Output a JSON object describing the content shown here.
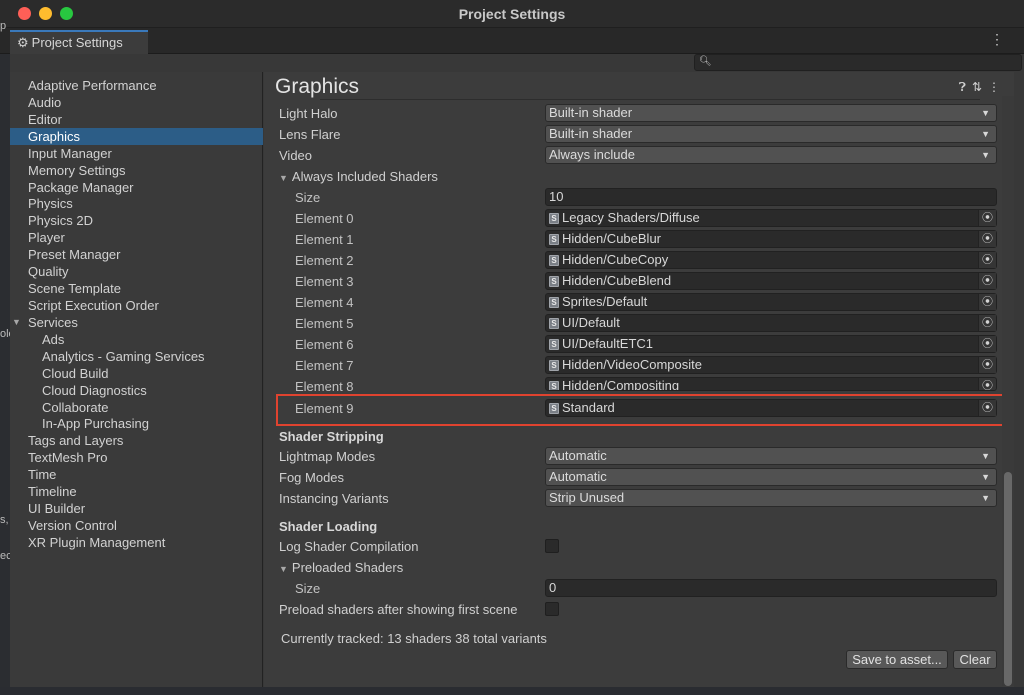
{
  "window": {
    "title": "Project Settings"
  },
  "tab": {
    "label": "Project Settings",
    "icon": "gear-icon"
  },
  "sidebar": {
    "items": [
      "Adaptive Performance",
      "Audio",
      "Editor",
      "Graphics",
      "Input Manager",
      "Memory Settings",
      "Package Manager",
      "Physics",
      "Physics 2D",
      "Player",
      "Preset Manager",
      "Quality",
      "Scene Template",
      "Script Execution Order",
      "Services",
      "Ads",
      "Analytics - Gaming Services",
      "Cloud Build",
      "Cloud Diagnostics",
      "Collaborate",
      "In-App Purchasing",
      "Tags and Layers",
      "TextMesh Pro",
      "Time",
      "Timeline",
      "UI Builder",
      "Version Control",
      "XR Plugin Management"
    ],
    "selected": "Graphics"
  },
  "main": {
    "title": "Graphics",
    "light_halo": {
      "label": "Light Halo",
      "value": "Built-in shader"
    },
    "lens_flare": {
      "label": "Lens Flare",
      "value": "Built-in shader"
    },
    "video": {
      "label": "Video",
      "value": "Always include"
    },
    "always_included": {
      "label": "Always Included Shaders",
      "size_label": "Size",
      "size": "10",
      "elements": [
        {
          "label": "Element 0",
          "value": "Legacy Shaders/Diffuse"
        },
        {
          "label": "Element 1",
          "value": "Hidden/CubeBlur"
        },
        {
          "label": "Element 2",
          "value": "Hidden/CubeCopy"
        },
        {
          "label": "Element 3",
          "value": "Hidden/CubeBlend"
        },
        {
          "label": "Element 4",
          "value": "Sprites/Default"
        },
        {
          "label": "Element 5",
          "value": "UI/Default"
        },
        {
          "label": "Element 6",
          "value": "UI/DefaultETC1"
        },
        {
          "label": "Element 7",
          "value": "Hidden/VideoComposite"
        },
        {
          "label": "Element 8",
          "value": "Hidden/Compositing"
        },
        {
          "label": "Element 9",
          "value": "Standard"
        }
      ]
    },
    "stripping": {
      "heading": "Shader Stripping",
      "lightmap": {
        "label": "Lightmap Modes",
        "value": "Automatic"
      },
      "fog": {
        "label": "Fog Modes",
        "value": "Automatic"
      },
      "instancing": {
        "label": "Instancing Variants",
        "value": "Strip Unused"
      }
    },
    "loading": {
      "heading": "Shader Loading",
      "log_label": "Log Shader Compilation",
      "preloaded_label": "Preloaded Shaders",
      "size_label": "Size",
      "size": "0",
      "preload_after_label": "Preload shaders after showing first scene"
    },
    "tracked": "Currently tracked: 13 shaders 38 total variants",
    "save_button": "Save to asset...",
    "clear_button": "Clear"
  },
  "bleed_left": [
    "p",
    "ole",
    "s,",
    "ec"
  ]
}
